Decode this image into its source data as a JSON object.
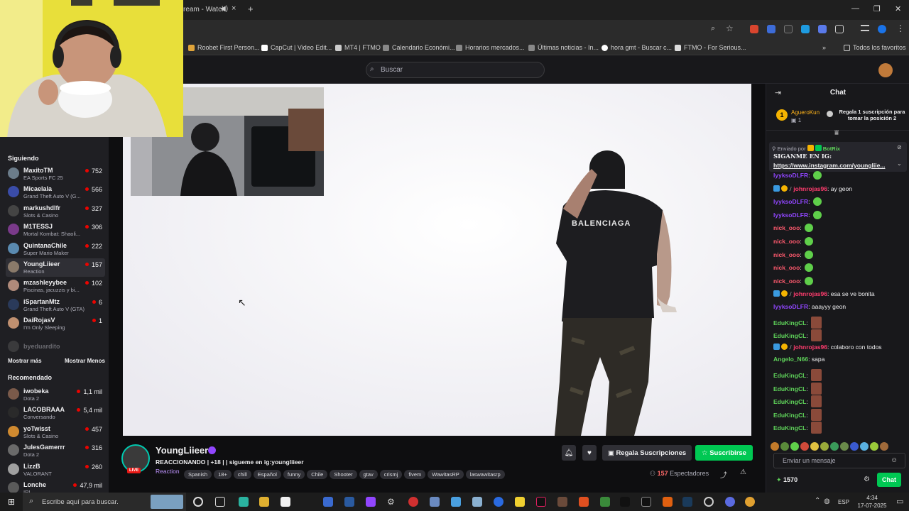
{
  "browser": {
    "tab_title": "ream - Watch",
    "new_tab": "+",
    "close_tab": "×",
    "bookmarks": [
      {
        "label": "Roobet First Person...",
        "color": "#e0a43a"
      },
      {
        "label": "CapCut | Video Edit...",
        "color": "#ffffff"
      },
      {
        "label": "MT4 | FTMO",
        "color": "#cccccc"
      },
      {
        "label": "Calendario Económi...",
        "color": "#bbbbbb"
      },
      {
        "label": "Horarios mercados...",
        "color": "#bbbbbb"
      },
      {
        "label": "Últimas noticias - In...",
        "color": "#bbbbbb"
      },
      {
        "label": "hora gmt - Buscar c...",
        "color": "#ffffff"
      },
      {
        "label": "FTMO - For Serious...",
        "color": "#dddddd"
      }
    ],
    "all_bookmarks": "Todos los favoritos"
  },
  "topnav": {
    "search_placeholder": "Buscar"
  },
  "sidebar": {
    "following_title": "Siguiendo",
    "following": [
      {
        "name": "MaxitoTM",
        "game": "EA Sports FC 25",
        "viewers": "752",
        "color": "#6b7c8a"
      },
      {
        "name": "Micaelala",
        "game": "Grand Theft Auto V (G...",
        "viewers": "566",
        "color": "#3a4ca8"
      },
      {
        "name": "markushdlfr",
        "game": "Slots & Casino",
        "viewers": "327",
        "color": "#444444"
      },
      {
        "name": "M1TESSJ",
        "game": "Mortal Kombat: Shaoli...",
        "viewers": "306",
        "color": "#7a3a8a"
      },
      {
        "name": "QuintanaChile",
        "game": "Super Mario Maker",
        "viewers": "222",
        "color": "#5a8ab0"
      },
      {
        "name": "YoungLiieer",
        "game": "Reaction",
        "viewers": "157",
        "color": "#8a7a6a"
      },
      {
        "name": "mzashleyybee",
        "game": "Piscinas, jacuzzis y bi...",
        "viewers": "102",
        "color": "#b08a7a"
      },
      {
        "name": "iSpartanMtz",
        "game": "Grand Theft Auto V (GTA)",
        "viewers": "6",
        "color": "#2a3a5a"
      },
      {
        "name": "DaiRojasV",
        "game": "I'm Only Sleeping",
        "viewers": "1",
        "color": "#c09070"
      }
    ],
    "offline": "byeduardito",
    "show_more": "Mostrar más",
    "show_less": "Mostrar Menos",
    "recommended_title": "Recomendado",
    "recommended": [
      {
        "name": "iwobeka",
        "game": "Dota 2",
        "viewers": "1,1 mil",
        "color": "#7a5a4a"
      },
      {
        "name": "LACOBRAAA",
        "game": "Conversando",
        "viewers": "5,4 mil",
        "color": "#2a2a2a"
      },
      {
        "name": "yoTwisst",
        "game": "Slots & Casino",
        "viewers": "457",
        "color": "#d08a30"
      },
      {
        "name": "JulesGamerrr",
        "game": "Dota 2",
        "viewers": "316",
        "color": "#6a6a6a"
      },
      {
        "name": "LizzB",
        "game": "VALORANT",
        "viewers": "260",
        "color": "#a0a0a0"
      },
      {
        "name": "Lonche",
        "game": "IRL",
        "viewers": "47,9 mil",
        "color": "#5a5a5a"
      }
    ]
  },
  "video": {
    "shirt_text": "BALENCIAGA"
  },
  "channel": {
    "name": "YoungLiieer",
    "live_badge": "LIVE",
    "title": "REACCIONANDO | +18 | | sigueme en ig:youngliieer",
    "category": "Reaction",
    "tags": [
      "Spanish",
      "18+",
      "chill",
      "Español",
      "funny",
      "Chile",
      "Shooter",
      "gtav",
      "crismj",
      "fivem",
      "WawitasRP",
      "laswawitasrp"
    ],
    "gift_label": "Regala Suscripciones",
    "subscribe_label": "Suscribirse",
    "viewers": "157",
    "viewers_label": "Espectadores"
  },
  "chat": {
    "title": "Chat",
    "leader_rank": "1",
    "leader_name": "AgueroKun",
    "leader_count": "1",
    "gift_prompt": "Regala 1 suscripción para tomar la posición 2",
    "pinned_by_label": "Enviado por",
    "pinned_by": "BotRix",
    "pinned_text": "SIGANME EN IG:",
    "pinned_link": "https://www.instagram.com/youngliie...",
    "messages": [
      {
        "user": "lyyksoDLFR",
        "text": "",
        "emote": "green",
        "color": "#9146ff",
        "badges": false
      },
      {
        "user": "johnrojas96",
        "text": "ay geon",
        "emote": "",
        "color": "#ff3c6e",
        "badges": true
      },
      {
        "user": "lyyksoDLFR",
        "text": "",
        "emote": "green",
        "color": "#9146ff",
        "badges": false
      },
      {
        "user": "lyyksoDLFR",
        "text": "",
        "emote": "green",
        "color": "#9146ff",
        "badges": false
      },
      {
        "user": "nick_ooo",
        "text": "",
        "emote": "green",
        "color": "#ff5a6e",
        "badges": false
      },
      {
        "user": "nick_ooo",
        "text": "",
        "emote": "green",
        "color": "#ff5a6e",
        "badges": false
      },
      {
        "user": "nick_ooo",
        "text": "",
        "emote": "green",
        "color": "#ff5a6e",
        "badges": false
      },
      {
        "user": "nick_ooo",
        "text": "",
        "emote": "green",
        "color": "#ff5a6e",
        "badges": false
      },
      {
        "user": "nick_ooo",
        "text": "",
        "emote": "green",
        "color": "#ff5a6e",
        "badges": false
      },
      {
        "user": "johnrojas96",
        "text": "esa se ve bonita",
        "emote": "",
        "color": "#ff3c6e",
        "badges": true
      },
      {
        "user": "lyyksoDLFR",
        "text": "aaayyy geon",
        "emote": "",
        "color": "#9146ff",
        "badges": false
      },
      {
        "user": "EduKingCL",
        "text": "",
        "emote": "brown",
        "color": "#5fd35a",
        "badges": false
      },
      {
        "user": "EduKingCL",
        "text": "",
        "emote": "brown",
        "color": "#5fd35a",
        "badges": false
      },
      {
        "user": "johnrojas96",
        "text": "colaboro con todos",
        "emote": "",
        "color": "#ff3c6e",
        "badges": true
      },
      {
        "user": "Angelo_N66",
        "text": "sapa",
        "emote": "",
        "color": "#5fd35a",
        "badges": false
      },
      {
        "user": "EduKingCL",
        "text": "",
        "emote": "brown",
        "color": "#5fd35a",
        "badges": false
      },
      {
        "user": "EduKingCL",
        "text": "",
        "emote": "brown",
        "color": "#5fd35a",
        "badges": false
      },
      {
        "user": "EduKingCL",
        "text": "",
        "emote": "brown",
        "color": "#5fd35a",
        "badges": false
      },
      {
        "user": "EduKingCL",
        "text": "",
        "emote": "brown",
        "color": "#5fd35a",
        "badges": false
      },
      {
        "user": "EduKingCL",
        "text": "",
        "emote": "brown",
        "color": "#5fd35a",
        "badges": false
      }
    ],
    "input_placeholder": "Enviar un mensaje",
    "points": "1570",
    "send_label": "Chat"
  },
  "taskbar": {
    "search_placeholder": "Escribe aquí para buscar.",
    "lang": "ESP",
    "time": "4:34",
    "date": "17-07-2025"
  }
}
